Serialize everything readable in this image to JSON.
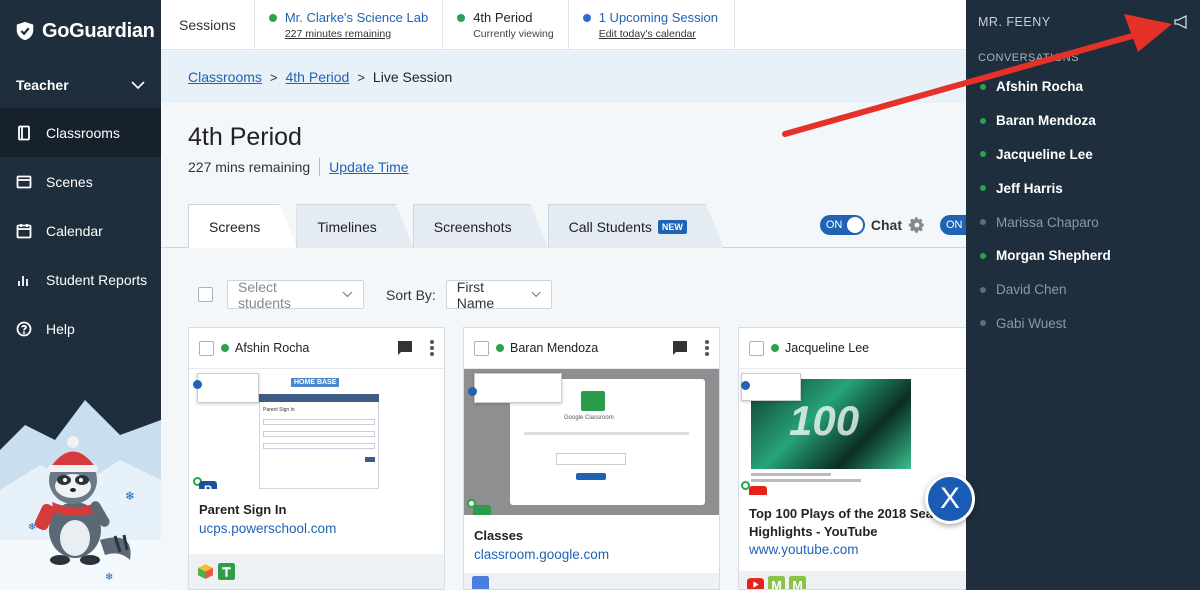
{
  "brand": {
    "name": "GoGuardian"
  },
  "leftnav": {
    "role": "Teacher",
    "items": [
      {
        "label": "Classrooms",
        "icon": "book-icon"
      },
      {
        "label": "Scenes",
        "icon": "scenes-icon"
      },
      {
        "label": "Calendar",
        "icon": "calendar-icon"
      },
      {
        "label": "Student Reports",
        "icon": "bar-chart-icon"
      },
      {
        "label": "Help",
        "icon": "help-icon"
      }
    ]
  },
  "topbar": {
    "sessions_label": "Sessions",
    "session1": {
      "title": "Mr. Clarke's Science Lab",
      "sub": "227 minutes remaining"
    },
    "session2": {
      "title": "4th Period",
      "sub": "Currently viewing"
    },
    "session3": {
      "title": "1 Upcoming Session",
      "sub": "Edit today's calendar"
    }
  },
  "breadcrumb": {
    "crumb1": "Classrooms",
    "crumb2": "4th Period",
    "current": "Live Session",
    "sep": ">"
  },
  "page": {
    "title": "4th Period",
    "remaining": "227 mins remaining",
    "update_time": "Update Time"
  },
  "tabs": [
    {
      "label": "Screens"
    },
    {
      "label": "Timelines"
    },
    {
      "label": "Screenshots"
    },
    {
      "label": "Call Students",
      "badge": "NEW"
    }
  ],
  "chat": {
    "toggle": "ON",
    "label": "Chat",
    "toggle2": "ON"
  },
  "filters": {
    "select_students": "Select students",
    "sort_by": "Sort By:",
    "sort_value": "First Name"
  },
  "cards": [
    {
      "student": "Afshin Rocha",
      "title": "Parent Sign In",
      "url": "ucps.powerschool.com",
      "thumb_logo": "HOME BASE",
      "thumb_heading": "Parent Sign In",
      "site_icon_letter": "P"
    },
    {
      "student": "Baran Mendoza",
      "title": "Classes",
      "url": "classroom.google.com",
      "thumb_heading": "Google Classroom"
    },
    {
      "student": "Jacqueline Lee",
      "title": "Top 100 Plays of the 2018 Season Highlights - YouTube",
      "url": "www.youtube.com",
      "thumb_overlay": "100"
    }
  ],
  "fab": {
    "label": "X"
  },
  "rpanel": {
    "title": "MR. FEENY",
    "conversations_label": "CONVERSATIONS",
    "students": [
      {
        "name": "Afshin Rocha",
        "online": true
      },
      {
        "name": "Baran Mendoza",
        "online": true
      },
      {
        "name": "Jacqueline Lee",
        "online": true
      },
      {
        "name": "Jeff Harris",
        "online": true
      },
      {
        "name": "Marissa Chaparo",
        "online": false
      },
      {
        "name": "Morgan Shepherd",
        "online": true
      },
      {
        "name": "David Chen",
        "online": false
      },
      {
        "name": "Gabi Wuest",
        "online": false
      }
    ]
  },
  "colors": {
    "nav_bg": "#1f2e3c",
    "accent": "#1f63b5",
    "online": "#2ca24d",
    "arrow": "#e53127"
  }
}
